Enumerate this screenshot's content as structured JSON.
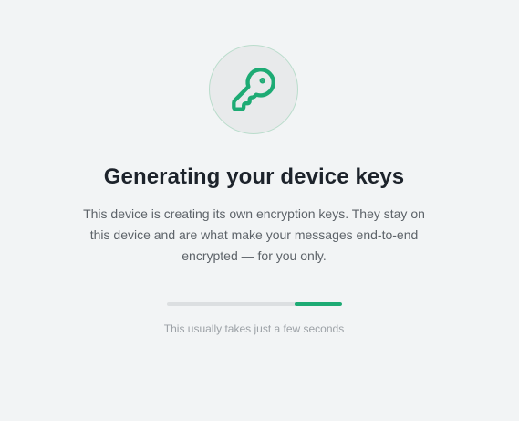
{
  "icon": {
    "name": "key-icon",
    "accent_color": "#1dab74"
  },
  "title": "Generating your device keys",
  "description": "This device is creating its own encryption keys. They stay on this device and are what make your messages end-to-end encrypted — for you only.",
  "progress": {
    "start_fraction": 0.73,
    "end_fraction": 1.0,
    "indeterminate": true,
    "color": "#1dab74"
  },
  "hint": "This usually takes just a few seconds"
}
